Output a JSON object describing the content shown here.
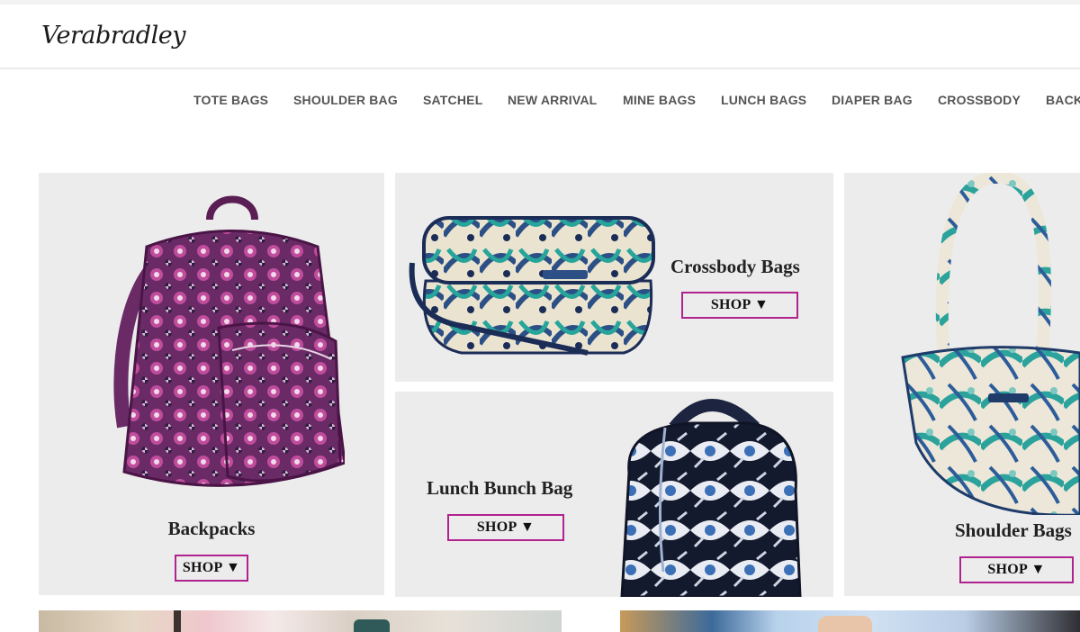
{
  "brand": {
    "logo_text": "Verabradley"
  },
  "nav": {
    "items": [
      "TOTE BAGS",
      "SHOULDER BAG",
      "SATCHEL",
      "NEW ARRIVAL",
      "MINE BAGS",
      "LUNCH BAGS",
      "DIAPER BAG",
      "CROSSBODY",
      "BACK"
    ]
  },
  "tiles": {
    "backpacks": {
      "title": "Backpacks",
      "shop": "SHOP ▼"
    },
    "crossbody": {
      "title": "Crossbody Bags",
      "shop": "SHOP ▼"
    },
    "lunch": {
      "title": "Lunch Bunch Bag",
      "shop": "SHOP ▼"
    },
    "shoulder": {
      "title": "Shoulder Bags",
      "shop": "SHOP ▼"
    }
  },
  "colors": {
    "tile_bg": "#ececec",
    "shop_border": "#b0238f",
    "nav_text": "#555555"
  }
}
